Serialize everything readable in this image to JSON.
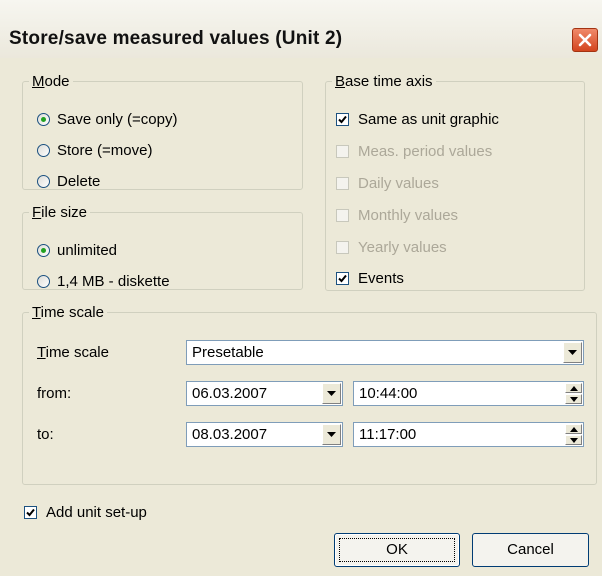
{
  "window": {
    "title": "Store/save measured values (Unit 2)"
  },
  "mode": {
    "legend": "Mode",
    "legend_mnemonic": "M",
    "options": [
      {
        "label": "Save only (=copy)",
        "selected": true
      },
      {
        "label": "Store (=move)",
        "selected": false
      },
      {
        "label": "Delete",
        "selected": false
      }
    ]
  },
  "file_size": {
    "legend": "File size",
    "legend_mnemonic": "F",
    "options": [
      {
        "label": "unlimited",
        "selected": true
      },
      {
        "label": "1,4 MB - diskette",
        "selected": false
      }
    ]
  },
  "base_time_axis": {
    "legend": "Base time axis",
    "legend_mnemonic": "B",
    "options": [
      {
        "label": "Same as unit graphic",
        "checked": true,
        "enabled": true
      },
      {
        "label": "Meas. period values",
        "checked": false,
        "enabled": false
      },
      {
        "label": "Daily values",
        "checked": false,
        "enabled": false
      },
      {
        "label": "Monthly values",
        "checked": false,
        "enabled": false
      },
      {
        "label": "Yearly values",
        "checked": false,
        "enabled": false
      },
      {
        "label": "Events",
        "checked": true,
        "enabled": true
      }
    ]
  },
  "time_scale": {
    "legend": "Time scale",
    "legend_mnemonic": "T",
    "scale_label": "Time scale",
    "scale_value": "Presetable",
    "from_label": "from:",
    "from_date": "06.03.2007",
    "from_time": "10:44:00",
    "to_label": "to:",
    "to_date": "08.03.2007",
    "to_time": "11:17:00"
  },
  "add_unit_setup": {
    "label": "Add unit set-up",
    "checked": true
  },
  "buttons": {
    "ok": "OK",
    "cancel": "Cancel"
  },
  "icons": {
    "close": "close-icon",
    "dropdown": "chevron-down-icon",
    "spin": "spin-arrows-icon",
    "check": "checkmark-icon"
  }
}
